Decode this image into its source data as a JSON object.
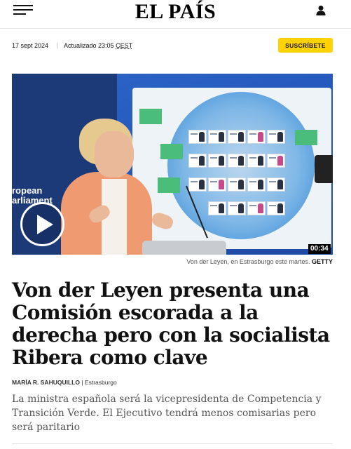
{
  "header": {
    "logo": "EL PAÍS",
    "menu_icon": "menu-icon",
    "user_icon": "user-icon"
  },
  "meta": {
    "date": "17 sept 2024",
    "separator": "|",
    "updated_label": "Actualizado 23:05",
    "timezone": "CEST",
    "subscribe_label": "SUSCRÍBETE"
  },
  "media": {
    "overlay_text": "ropean\narliament",
    "play_icon": "play-icon",
    "duration": "00:34",
    "caption": "Von der Leyen, en Estrasburgo este martes.",
    "credit": "GETTY"
  },
  "article": {
    "headline": "Von der Leyen presenta una Comisión escorada a la derecha pero con la socialista Ribera como clave",
    "author": "María R. Sahuquillo",
    "byline_sep": "|",
    "location": "Estrasburgo",
    "standfirst": "La ministra española será la vicepresidenta de Competencia y Transición Verde. El Ejecutivo tendrá menos comisarias pero será paritario"
  },
  "colors": {
    "subscribe_bg": "#ffd200",
    "text": "#111111",
    "standfirst": "#555555"
  }
}
